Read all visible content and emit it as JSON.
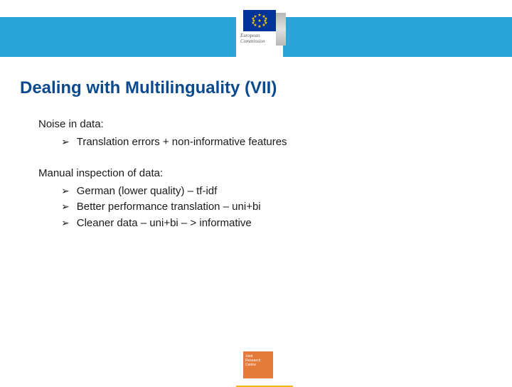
{
  "header": {
    "logo_line1": "European",
    "logo_line2": "Commission"
  },
  "title": "Dealing with Multilinguality (VII)",
  "sections": [
    {
      "label": "Noise in data:",
      "bullets": [
        "Translation errors + non-informative features"
      ]
    },
    {
      "label": "Manual inspection of data:",
      "bullets": [
        "German (lower quality) – tf-idf",
        "Better performance translation – uni+bi",
        "Cleaner data – uni+bi – > informative"
      ]
    }
  ],
  "footer": {
    "badge_line1": "Joint",
    "badge_line2": "Research",
    "badge_line3": "Centre"
  },
  "bullet_char": "➢"
}
